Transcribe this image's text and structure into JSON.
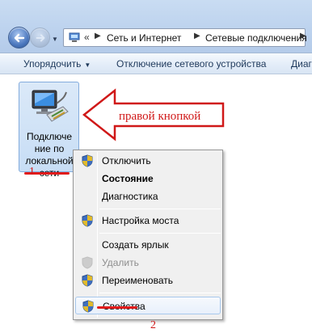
{
  "address_bar": {
    "overflow": "«",
    "crumbs": [
      "Сеть и Интернет",
      "Сетевые подключения"
    ]
  },
  "toolbar": {
    "organize": "Упорядочить",
    "disable_device": "Отключение сетевого устройства",
    "diag_truncated": "Диаг"
  },
  "network_item": {
    "label_lines": [
      "Подключе",
      "ние по",
      "локальной",
      "сети"
    ]
  },
  "annotations": {
    "right_click_text": "правой кнопкой",
    "marker_1": "1",
    "marker_2": "2",
    "accent_color": "#d01818"
  },
  "context_menu": {
    "items": [
      {
        "label": "Отключить",
        "icon": "shield-icon"
      },
      {
        "label": "Состояние",
        "bold": true
      },
      {
        "label": "Диагностика"
      },
      {
        "label": "Настройка моста",
        "icon": "shield-icon"
      },
      {
        "label": "Создать ярлык"
      },
      {
        "label": "Удалить",
        "icon": "shield-icon",
        "disabled": true
      },
      {
        "label": "Переименовать",
        "icon": "shield-icon"
      },
      {
        "label": "Свойства",
        "icon": "shield-icon",
        "highlighted": true
      }
    ]
  }
}
